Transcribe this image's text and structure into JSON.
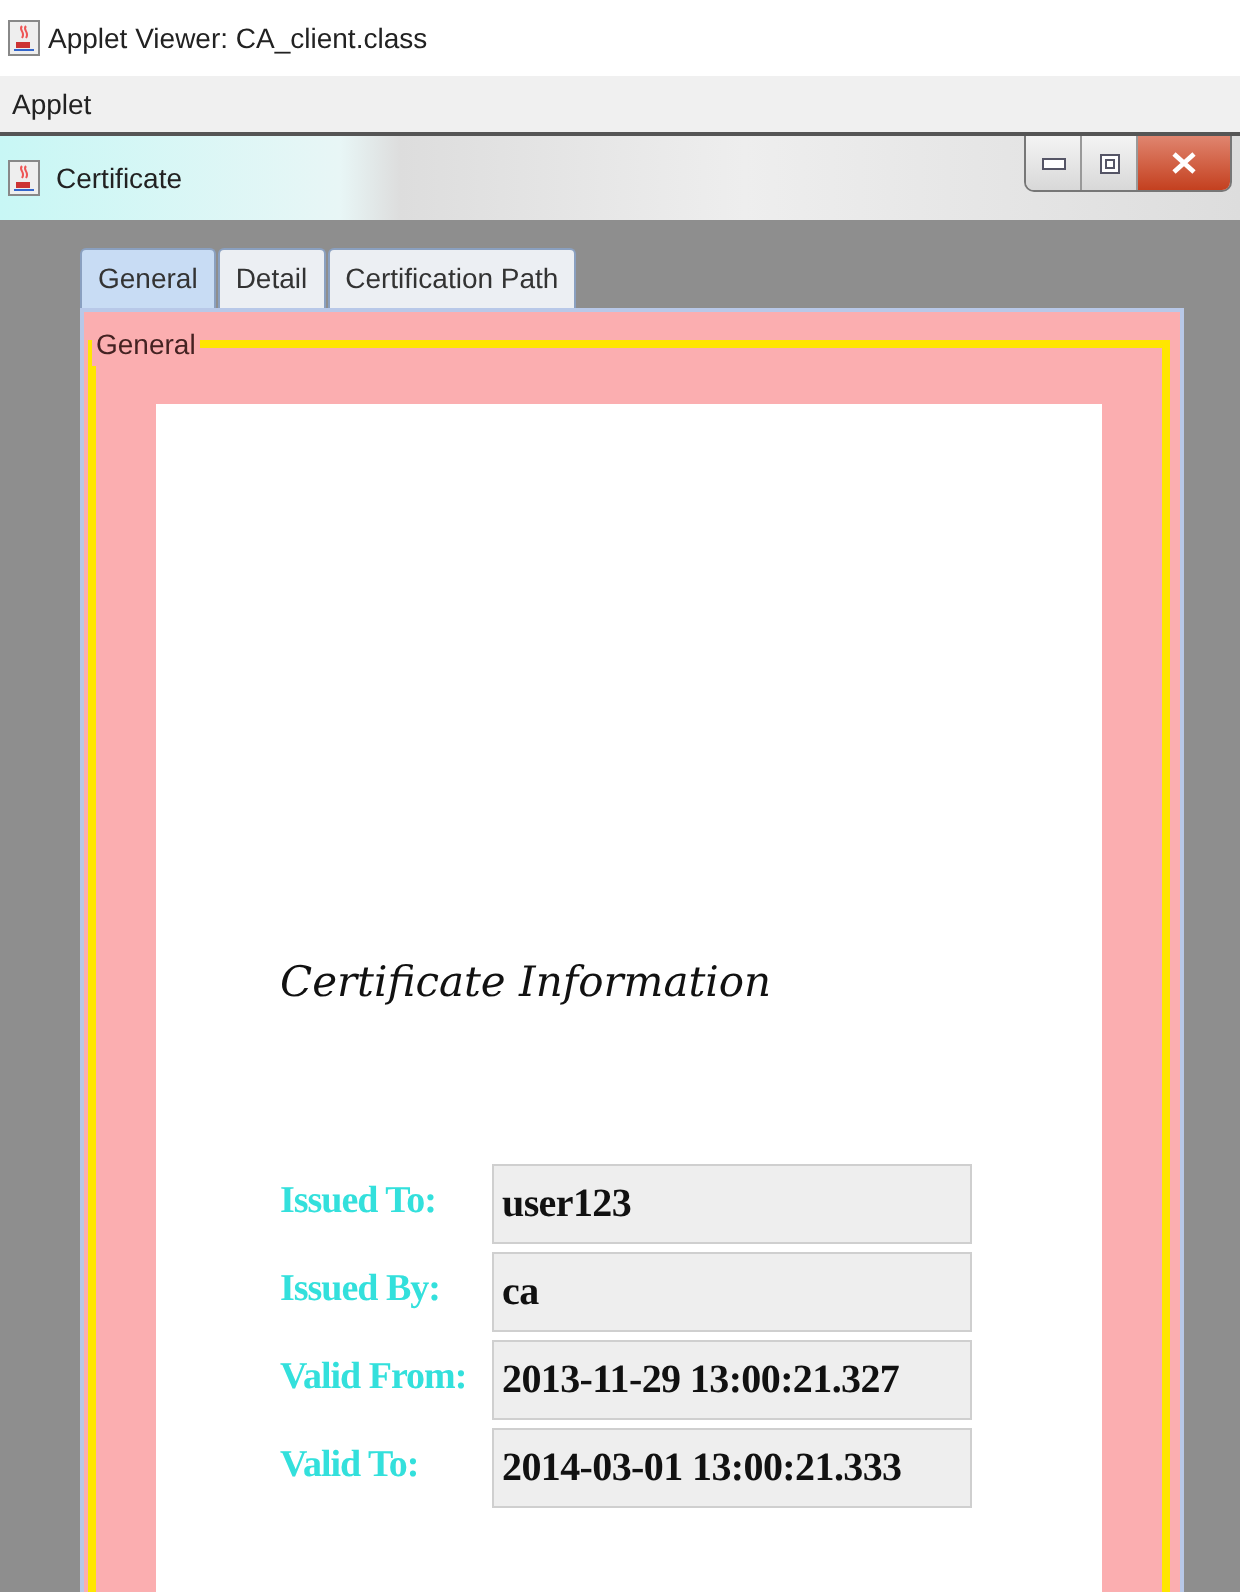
{
  "window": {
    "title": "Applet Viewer: CA_client.class"
  },
  "menu": [
    "Applet"
  ],
  "dialog": {
    "title": "Certificate"
  },
  "tabs": [
    {
      "label": "General",
      "selected": true
    },
    {
      "label": "Detail",
      "selected": false
    },
    {
      "label": "Certification Path",
      "selected": false
    }
  ],
  "group": {
    "title": "General"
  },
  "heading": "Certificate Information",
  "fields": [
    {
      "label": "Issued To:",
      "value": "user123"
    },
    {
      "label": "Issued By:",
      "value": "ca"
    },
    {
      "label": "Valid From:",
      "value": "2013-11-29 13:00:21.327"
    },
    {
      "label": "Valid To:",
      "value": "2014-03-01 13:00:21.333"
    }
  ]
}
